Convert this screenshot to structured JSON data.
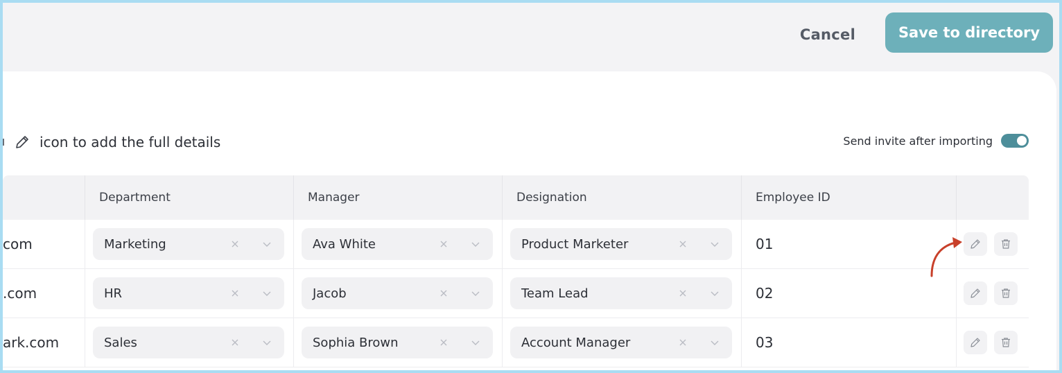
{
  "header": {
    "cancel_label": "Cancel",
    "save_label": "Save to directory"
  },
  "hint": {
    "text": "icon to add the full details"
  },
  "invite": {
    "label": "Send invite after importing",
    "enabled": true
  },
  "table": {
    "columns": [
      "",
      "Department",
      "Manager",
      "Designation",
      "Employee ID",
      ""
    ],
    "rows": [
      {
        "email": "com",
        "department": "Marketing",
        "manager": "Ava White",
        "designation": "Product Marketer",
        "employee_id": "01"
      },
      {
        "email": ".com",
        "department": "HR",
        "manager": "Jacob",
        "designation": "Team Lead",
        "employee_id": "02"
      },
      {
        "email": "ark.com",
        "department": "Sales",
        "manager": "Sophia Brown",
        "designation": "Account Manager",
        "employee_id": "03"
      }
    ]
  },
  "colors": {
    "accent": "#6db0ba",
    "toggle_on": "#4d8e9a",
    "annotation_arrow": "#c8402a"
  },
  "icons": {
    "hint": "pencil-icon",
    "select_clear": "close-icon",
    "select_open": "chevron-down-icon",
    "edit": "pencil-icon",
    "delete": "trash-icon"
  }
}
